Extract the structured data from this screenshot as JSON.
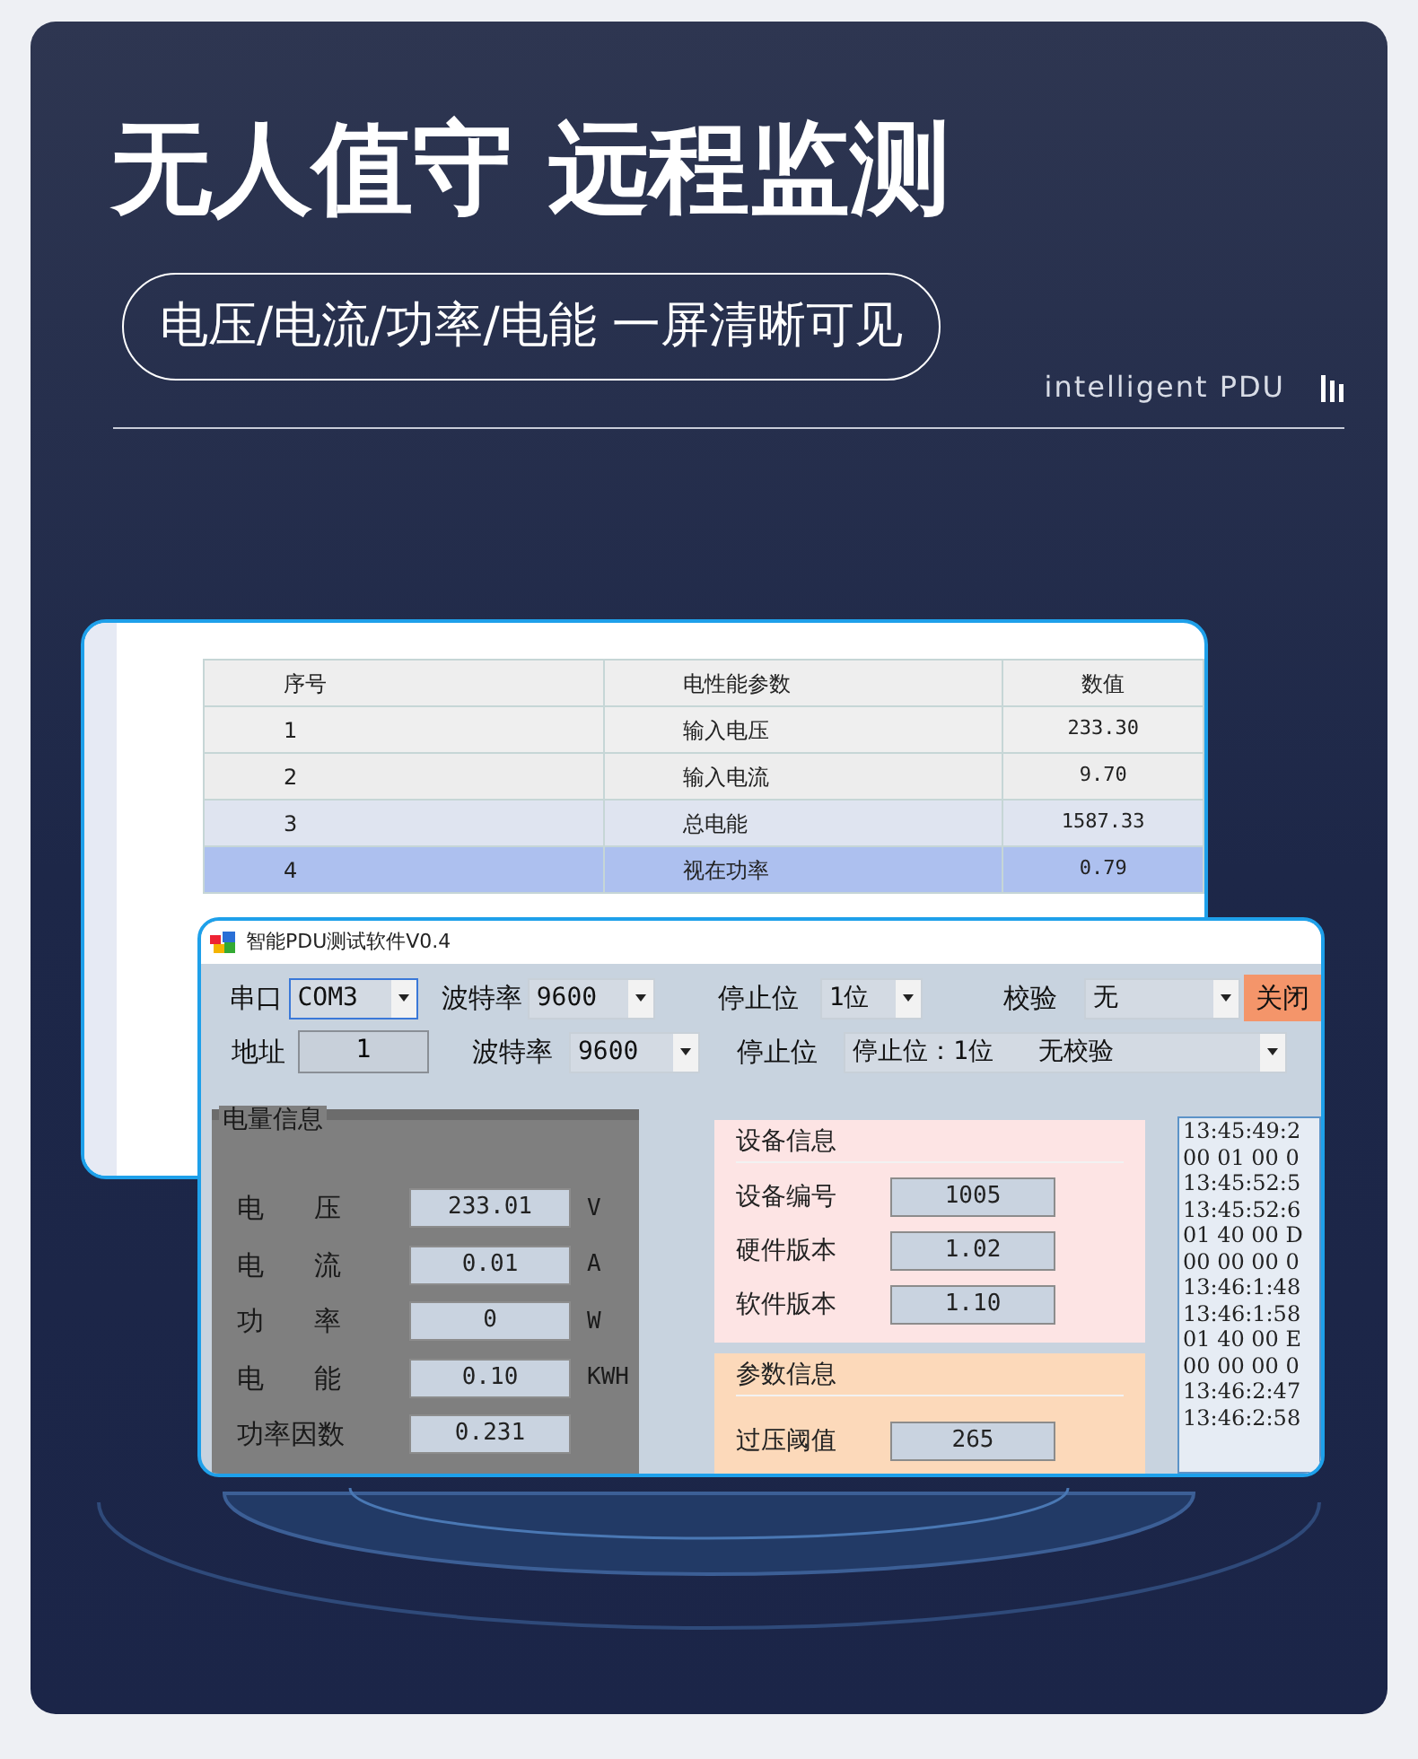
{
  "headline": "无人值守 远程监测",
  "subtitle": "电压/电流/功率/电能 一屏清晰可见",
  "tagline": "intelligent PDU",
  "table_window": {
    "columns": [
      "序号",
      "电性能参数",
      "数值"
    ],
    "rows": [
      {
        "cells": [
          "1",
          "输入电压",
          "233.30"
        ]
      },
      {
        "cells": [
          "2",
          "输入电流",
          "9.70"
        ]
      },
      {
        "cells": [
          "3",
          "总电能",
          "1587.33"
        ]
      },
      {
        "cells": [
          "4",
          "视在功率",
          "0.79"
        ]
      }
    ]
  },
  "app_window": {
    "title": "智能PDU测试软件V0.4",
    "toolbar_rows": [
      [
        {
          "kind": "label",
          "text": "串口"
        },
        {
          "kind": "select",
          "value": "COM3",
          "focused": true
        },
        {
          "kind": "label",
          "text": "波特率"
        },
        {
          "kind": "select",
          "value": "9600",
          "focused": false
        },
        {
          "kind": "label",
          "text": "停止位"
        },
        {
          "kind": "select",
          "value": "1位",
          "focused": false
        },
        {
          "kind": "label",
          "text": "校验"
        },
        {
          "kind": "select",
          "value": "无",
          "focused": false
        },
        {
          "kind": "button",
          "text": "关闭"
        }
      ],
      [
        {
          "kind": "label",
          "text": "地址"
        },
        {
          "kind": "field",
          "value": "1"
        },
        {
          "kind": "label",
          "text": "波特率"
        },
        {
          "kind": "select",
          "value": "9600",
          "focused": false
        },
        {
          "kind": "label",
          "text": "停止位"
        },
        {
          "kind": "select",
          "value": "停止位：1位   无校验",
          "focused": false
        }
      ]
    ],
    "power_panel": {
      "title": "电量信息",
      "rows": [
        {
          "label": "电 压",
          "value": "233.01",
          "unit": "V"
        },
        {
          "label": "电 流",
          "value": "0.01",
          "unit": "A"
        },
        {
          "label": "功 率",
          "value": "0",
          "unit": "W"
        },
        {
          "label": "电 能",
          "value": "0.10",
          "unit": "KWH"
        },
        {
          "label": "功率因数",
          "value": "0.231"
        }
      ]
    },
    "device_panel": {
      "title": "设备信息",
      "rows": [
        {
          "label": "设备编号",
          "value": "1005"
        },
        {
          "label": "硬件版本",
          "value": "1.02"
        },
        {
          "label": "软件版本",
          "value": "1.10"
        }
      ]
    },
    "param_panel": {
      "title": "参数信息",
      "rows": [
        {
          "label": "过压阈值",
          "value": "265"
        }
      ]
    },
    "log_lines": [
      "13:45:49:2",
      "00 01 00 0",
      "13:45:52:5",
      "13:45:52:6",
      "01 40 00 D",
      "00 00 00 0",
      "13:46:1:48",
      "13:46:1:58",
      "01 40 00 E",
      "00 00 00 0",
      "13:46:2:47",
      "13:46:2:58"
    ]
  }
}
